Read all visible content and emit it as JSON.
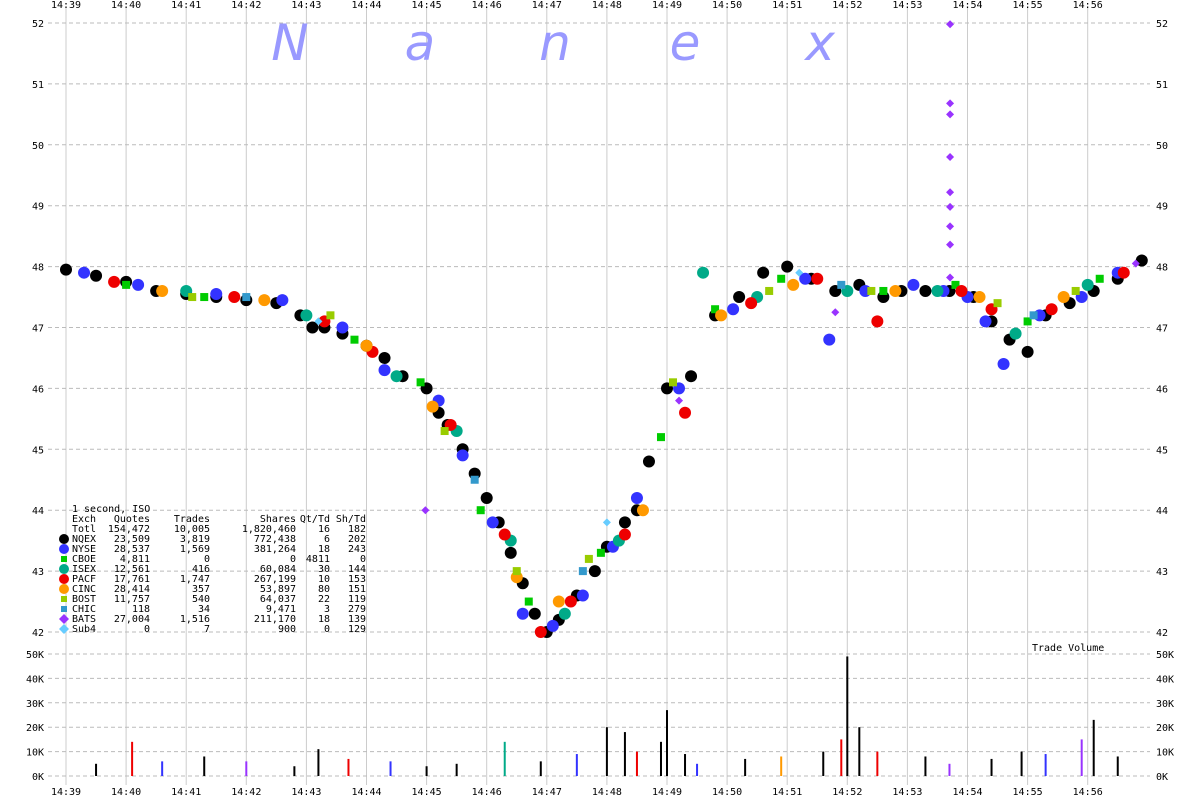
{
  "watermark": [
    "N",
    "a",
    "n",
    "e",
    "x"
  ],
  "chart_data": [
    {
      "type": "scatter",
      "title": "",
      "x_ticks": [
        "14:39",
        "14:40",
        "14:41",
        "14:42",
        "14:43",
        "14:44",
        "14:45",
        "14:46",
        "14:47",
        "14:48",
        "14:49",
        "14:50",
        "14:51",
        "14:52",
        "14:53",
        "14:54",
        "14:55",
        "14:56"
      ],
      "y_ticks": [
        "42",
        "43",
        "44",
        "45",
        "46",
        "47",
        "48",
        "49",
        "50",
        "51",
        "52"
      ],
      "xlim": [
        0,
        18.1
      ],
      "ylim": [
        41.85,
        52.05
      ],
      "grid": true,
      "series": [
        {
          "name": "NQEX",
          "color": "#000000",
          "x": [
            0.0,
            0.5,
            1.0,
            1.5,
            2.0,
            2.5,
            3.0,
            3.5,
            3.9,
            4.1,
            4.3,
            4.6,
            5.0,
            5.3,
            5.6,
            6.0,
            6.2,
            6.35,
            6.6,
            6.8,
            7.0,
            7.2,
            7.4,
            7.6,
            7.8,
            8.0,
            8.2,
            8.5,
            8.8,
            9.0,
            9.3,
            9.5,
            9.7,
            10.0,
            10.4,
            10.8,
            11.2,
            11.6,
            12.0,
            12.4,
            12.8,
            13.2,
            13.6,
            13.9,
            14.3,
            14.7,
            15.1,
            15.4,
            15.7,
            16.0,
            16.3,
            16.7,
            17.1,
            17.5,
            17.9
          ],
          "y": [
            47.95,
            47.85,
            47.75,
            47.6,
            47.55,
            47.5,
            47.45,
            47.4,
            47.2,
            47.0,
            47.0,
            46.9,
            46.7,
            46.5,
            46.2,
            46.0,
            45.6,
            45.4,
            45.0,
            44.6,
            44.2,
            43.8,
            43.3,
            42.8,
            42.3,
            42.0,
            42.2,
            42.6,
            43.0,
            43.4,
            43.8,
            44.0,
            44.8,
            46.0,
            46.2,
            47.2,
            47.5,
            47.9,
            48.0,
            47.8,
            47.6,
            47.7,
            47.5,
            47.6,
            47.6,
            47.6,
            47.5,
            47.1,
            46.8,
            46.6,
            47.2,
            47.4,
            47.6,
            47.8,
            48.1
          ]
        },
        {
          "name": "NYSE",
          "color": "#3333ff",
          "x": [
            0.3,
            1.2,
            2.5,
            3.6,
            4.6,
            5.3,
            6.2,
            6.6,
            7.1,
            7.6,
            8.1,
            8.6,
            9.1,
            9.5,
            10.2,
            11.1,
            12.3,
            12.7,
            13.3,
            14.1,
            14.6,
            15.0,
            15.3,
            15.6,
            16.2,
            16.9,
            17.5
          ],
          "y": [
            47.9,
            47.7,
            47.55,
            47.45,
            47.0,
            46.3,
            45.8,
            44.9,
            43.8,
            42.3,
            42.1,
            42.6,
            43.4,
            44.2,
            46.0,
            47.3,
            47.8,
            46.8,
            47.6,
            47.7,
            47.6,
            47.5,
            47.1,
            46.4,
            47.2,
            47.5,
            47.9
          ]
        },
        {
          "name": "CBOE",
          "color": "#00cc00",
          "x": [
            1.0,
            2.3,
            4.8,
            5.9,
            6.9,
            7.7,
            8.9,
            9.9,
            10.8,
            11.9,
            13.6,
            14.8,
            16.0,
            17.2
          ],
          "y": [
            47.7,
            47.5,
            46.8,
            46.1,
            44.0,
            42.5,
            43.3,
            45.2,
            47.3,
            47.8,
            47.6,
            47.7,
            47.1,
            47.8
          ]
        },
        {
          "name": "ISEX",
          "color": "#00aa88",
          "x": [
            2.0,
            4.0,
            5.5,
            6.5,
            7.4,
            8.3,
            9.2,
            10.6,
            11.5,
            13.0,
            14.5,
            15.8,
            17.0
          ],
          "y": [
            47.6,
            47.2,
            46.2,
            45.3,
            43.5,
            42.3,
            43.5,
            47.9,
            47.5,
            47.6,
            47.6,
            46.9,
            47.7
          ]
        },
        {
          "name": "PACF",
          "color": "#ee0000",
          "x": [
            0.8,
            2.8,
            4.3,
            5.1,
            6.4,
            7.3,
            7.9,
            8.4,
            9.3,
            10.3,
            11.4,
            12.5,
            13.5,
            14.9,
            15.4,
            16.4,
            17.6
          ],
          "y": [
            47.75,
            47.5,
            47.1,
            46.6,
            45.4,
            43.6,
            42.0,
            42.5,
            43.6,
            45.6,
            47.4,
            47.8,
            47.1,
            47.6,
            47.3,
            47.3,
            47.9
          ]
        },
        {
          "name": "CINC",
          "color": "#ff9900",
          "x": [
            1.6,
            3.3,
            5.0,
            6.1,
            7.5,
            8.2,
            9.6,
            10.9,
            12.1,
            13.8,
            15.2,
            16.6
          ],
          "y": [
            47.6,
            47.45,
            46.7,
            45.7,
            42.9,
            42.5,
            44.0,
            47.2,
            47.7,
            47.6,
            47.5,
            47.5
          ]
        },
        {
          "name": "BOST",
          "color": "#99cc00",
          "x": [
            2.1,
            4.4,
            6.3,
            7.5,
            8.7,
            10.1,
            11.7,
            13.4,
            15.5,
            16.8
          ],
          "y": [
            47.5,
            47.2,
            45.3,
            43.0,
            43.2,
            46.1,
            47.6,
            47.6,
            47.4,
            47.6
          ]
        },
        {
          "name": "CHIC",
          "color": "#3399cc",
          "x": [
            3.0,
            6.8,
            8.6,
            12.9,
            16.1
          ],
          "y": [
            47.5,
            44.5,
            43.0,
            47.7,
            47.2
          ]
        },
        {
          "name": "BATS",
          "color": "#9933ff",
          "x": [
            5.98,
            14.71,
            14.71,
            14.71,
            14.71,
            14.71,
            14.71,
            14.71,
            14.71,
            14.71,
            10.2,
            12.8,
            17.8
          ],
          "y": [
            44.0,
            51.98,
            50.68,
            50.5,
            49.8,
            49.22,
            48.98,
            48.66,
            48.36,
            47.82,
            45.8,
            47.25,
            48.05
          ]
        },
        {
          "name": "Sub4",
          "color": "#66ccff",
          "x": [
            4.2,
            9.0,
            12.2
          ],
          "y": [
            47.1,
            43.8,
            47.9
          ]
        }
      ],
      "legend": {
        "title": "1 second, ISO",
        "header": [
          "Exch",
          "Quotes",
          "Trades",
          "Shares",
          "Qt/Td",
          "Sh/Td"
        ],
        "rows": [
          {
            "label": "Totl",
            "quotes": "154,472",
            "trades": "10,005",
            "shares": "1,820,460",
            "qt_td": "16",
            "sh_td": "182",
            "marker": "none",
            "color": "#000000"
          },
          {
            "label": "NQEX",
            "quotes": "23,509",
            "trades": "3,819",
            "shares": "772,438",
            "qt_td": "6",
            "sh_td": "202",
            "marker": "circle",
            "color": "#000000"
          },
          {
            "label": "NYSE",
            "quotes": "28,537",
            "trades": "1,569",
            "shares": "381,264",
            "qt_td": "18",
            "sh_td": "243",
            "marker": "circle",
            "color": "#3333ff"
          },
          {
            "label": "CBOE",
            "quotes": "4,811",
            "trades": "0",
            "shares": "0",
            "qt_td": "4811",
            "sh_td": "0",
            "marker": "square",
            "color": "#00cc00"
          },
          {
            "label": "ISEX",
            "quotes": "12,561",
            "trades": "416",
            "shares": "60,084",
            "qt_td": "30",
            "sh_td": "144",
            "marker": "circle",
            "color": "#00aa88"
          },
          {
            "label": "PACF",
            "quotes": "17,761",
            "trades": "1,747",
            "shares": "267,199",
            "qt_td": "10",
            "sh_td": "153",
            "marker": "circle",
            "color": "#ee0000"
          },
          {
            "label": "CINC",
            "quotes": "28,414",
            "trades": "357",
            "shares": "53,897",
            "qt_td": "80",
            "sh_td": "151",
            "marker": "circle",
            "color": "#ff9900"
          },
          {
            "label": "BOST",
            "quotes": "11,757",
            "trades": "540",
            "shares": "64,037",
            "qt_td": "22",
            "sh_td": "119",
            "marker": "square",
            "color": "#99cc00"
          },
          {
            "label": "CHIC",
            "quotes": "118",
            "trades": "34",
            "shares": "9,471",
            "qt_td": "3",
            "sh_td": "279",
            "marker": "square",
            "color": "#3399cc"
          },
          {
            "label": "BATS",
            "quotes": "27,004",
            "trades": "1,516",
            "shares": "211,170",
            "qt_td": "18",
            "sh_td": "139",
            "marker": "diamond",
            "color": "#9933ff"
          },
          {
            "label": "Sub4",
            "quotes": "0",
            "trades": "7",
            "shares": "900",
            "qt_td": "0",
            "sh_td": "129",
            "marker": "diamond",
            "color": "#66ccff"
          }
        ]
      }
    },
    {
      "type": "bar",
      "title": "Trade Volume",
      "y_ticks": [
        "0K",
        "10K",
        "20K",
        "30K",
        "40K",
        "50K"
      ],
      "ylim": [
        0,
        55000
      ],
      "x_ticks": [
        "14:39",
        "14:40",
        "14:41",
        "14:42",
        "14:43",
        "14:44",
        "14:45",
        "14:46",
        "14:47",
        "14:48",
        "14:49",
        "14:50",
        "14:51",
        "14:52",
        "14:53",
        "14:54",
        "14:55",
        "14:56"
      ],
      "x": [
        0.5,
        1.1,
        1.6,
        2.3,
        3.0,
        3.8,
        4.2,
        4.7,
        5.4,
        6.0,
        6.5,
        7.3,
        7.9,
        8.5,
        9.0,
        9.3,
        9.5,
        9.9,
        10.0,
        10.3,
        10.5,
        11.3,
        11.9,
        12.6,
        12.9,
        13.0,
        13.2,
        13.5,
        14.3,
        14.7,
        15.4,
        15.9,
        16.3,
        16.9,
        17.1,
        17.5
      ],
      "values": [
        5000,
        14000,
        6000,
        8000,
        6000,
        4000,
        11000,
        7000,
        6000,
        4000,
        5000,
        14000,
        6000,
        9000,
        20000,
        18000,
        10000,
        14000,
        27000,
        9000,
        5000,
        7000,
        8000,
        10000,
        15000,
        49000,
        20000,
        10000,
        8000,
        5000,
        7000,
        10000,
        9000,
        15000,
        23000,
        8000
      ],
      "colors": [
        "#000000",
        "#ee0000",
        "#3333ff",
        "#000000",
        "#9933ff",
        "#000000",
        "#000000",
        "#ee0000",
        "#3333ff",
        "#000000",
        "#000000",
        "#00aa88",
        "#000000",
        "#3333ff",
        "#000000",
        "#000000",
        "#ee0000",
        "#000000",
        "#000000",
        "#000000",
        "#3333ff",
        "#000000",
        "#ff9900",
        "#000000",
        "#ee0000",
        "#000000",
        "#000000",
        "#ee0000",
        "#000000",
        "#9933ff",
        "#000000",
        "#000000",
        "#3333ff",
        "#9933ff",
        "#000000",
        "#000000"
      ]
    }
  ]
}
